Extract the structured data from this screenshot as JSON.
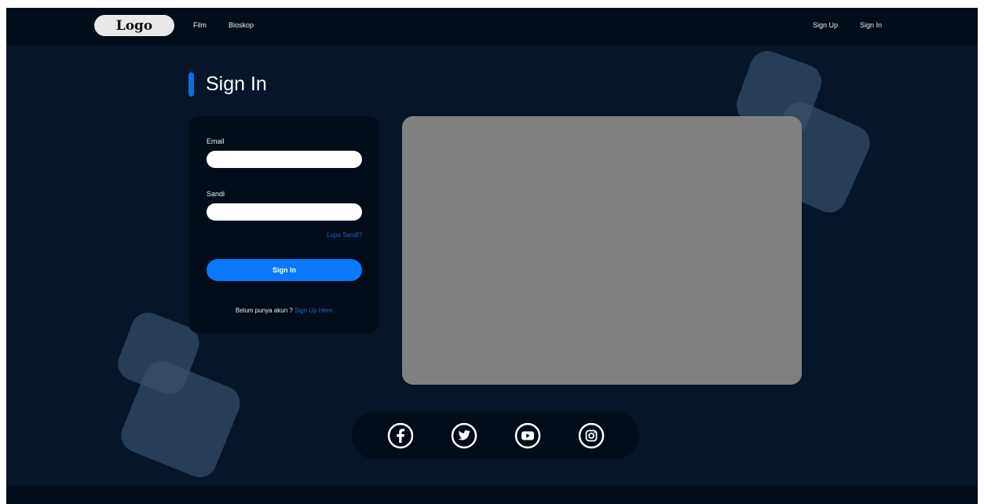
{
  "header": {
    "logo": "Logo",
    "nav": [
      "Film",
      "Bioskop"
    ],
    "sign_up": "Sign Up",
    "sign_in": "Sign In"
  },
  "page": {
    "title": "Sign In"
  },
  "form": {
    "email_label": "Email",
    "email_value": "",
    "password_label": "Sandi",
    "password_value": "",
    "forgot_link": "Lupa Sandi?",
    "submit_label": "Sign In",
    "register_prompt": "Belum punya akun ?",
    "register_link": "Sign Up Here"
  },
  "social": [
    "facebook-icon",
    "twitter-icon",
    "youtube-icon",
    "instagram-icon"
  ],
  "colors": {
    "background": "#061528",
    "bar": "#030d19",
    "accent": "#0a78ff",
    "link": "#1c66c2",
    "placeholder": "#808080"
  }
}
